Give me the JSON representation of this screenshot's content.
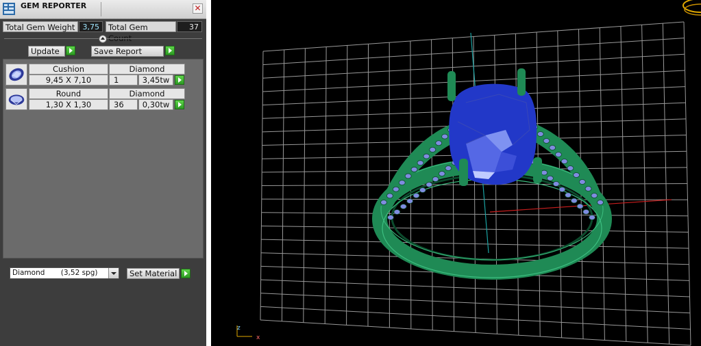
{
  "panel": {
    "title": "GEM REPORTER",
    "close_glyph": "✕",
    "total_weight_label": "Total Gem Weight",
    "total_weight_value": "3,75",
    "total_count_label": "Total Gem Count",
    "total_count_value": "37",
    "update_label": "Update",
    "save_report_label": "Save Report",
    "gems": [
      {
        "shape": "Cushion",
        "material": "Diamond",
        "size": "9,45 X 7,10",
        "count": "1",
        "weight": "3,45tw"
      },
      {
        "shape": "Round",
        "material": "Diamond",
        "size": "1,30 X 1,30",
        "count": "36",
        "weight": "0,30tw"
      }
    ],
    "material_select": {
      "value": "Diamond       (3,52 spg)"
    },
    "set_material_label": "Set Material"
  },
  "viewport": {
    "axis_labels": {
      "z": "z",
      "x": "x"
    },
    "colors": {
      "grid": "#9a9a9a",
      "ring": "#1f8a55",
      "gem": "#2238c8",
      "stones": "#7f8ce0",
      "axis_x": "#c81e1e",
      "axis_z": "#1aa3a3",
      "view_cube": "#e0a800"
    }
  }
}
